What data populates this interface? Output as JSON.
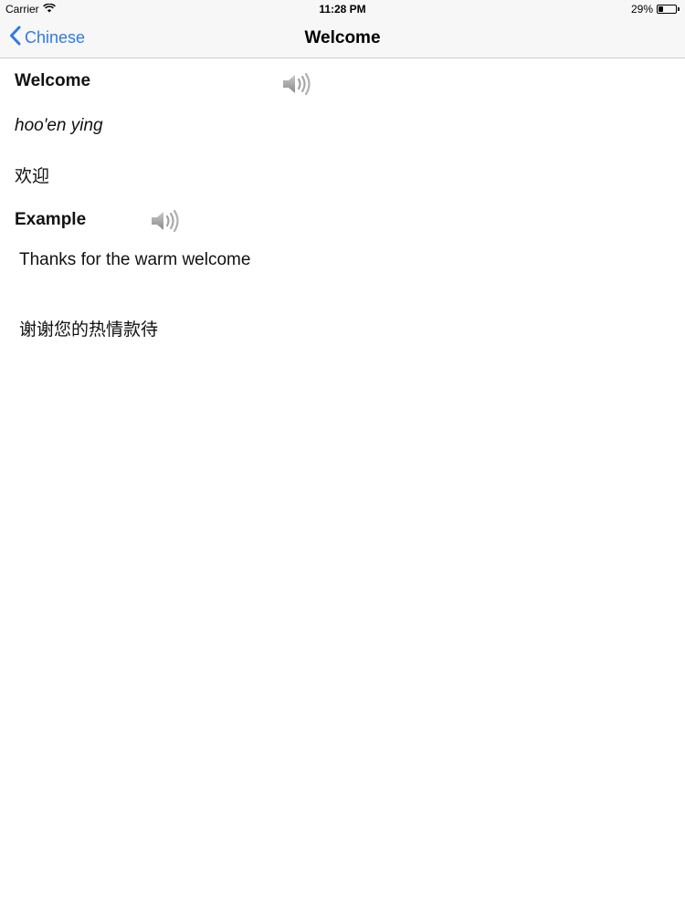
{
  "status_bar": {
    "carrier": "Carrier",
    "time": "11:28 PM",
    "battery": "29%",
    "battery_level": 0.29
  },
  "nav": {
    "back_label": "Chinese",
    "title": "Welcome"
  },
  "entry": {
    "word": "Welcome",
    "pinyin": "hoo'en ying",
    "hanzi": "欢迎",
    "example_heading": "Example",
    "example_english": "Thanks for the warm welcome",
    "example_chinese": "谢谢您的热情款待"
  },
  "icons": {
    "back": "chevron-left-icon",
    "speaker": "speaker-icon",
    "wifi": "wifi-icon",
    "battery": "battery-icon"
  },
  "colors": {
    "accent": "#2f7ae5",
    "nav_background": "#f7f7f7",
    "speaker": "#9a9a9a"
  }
}
